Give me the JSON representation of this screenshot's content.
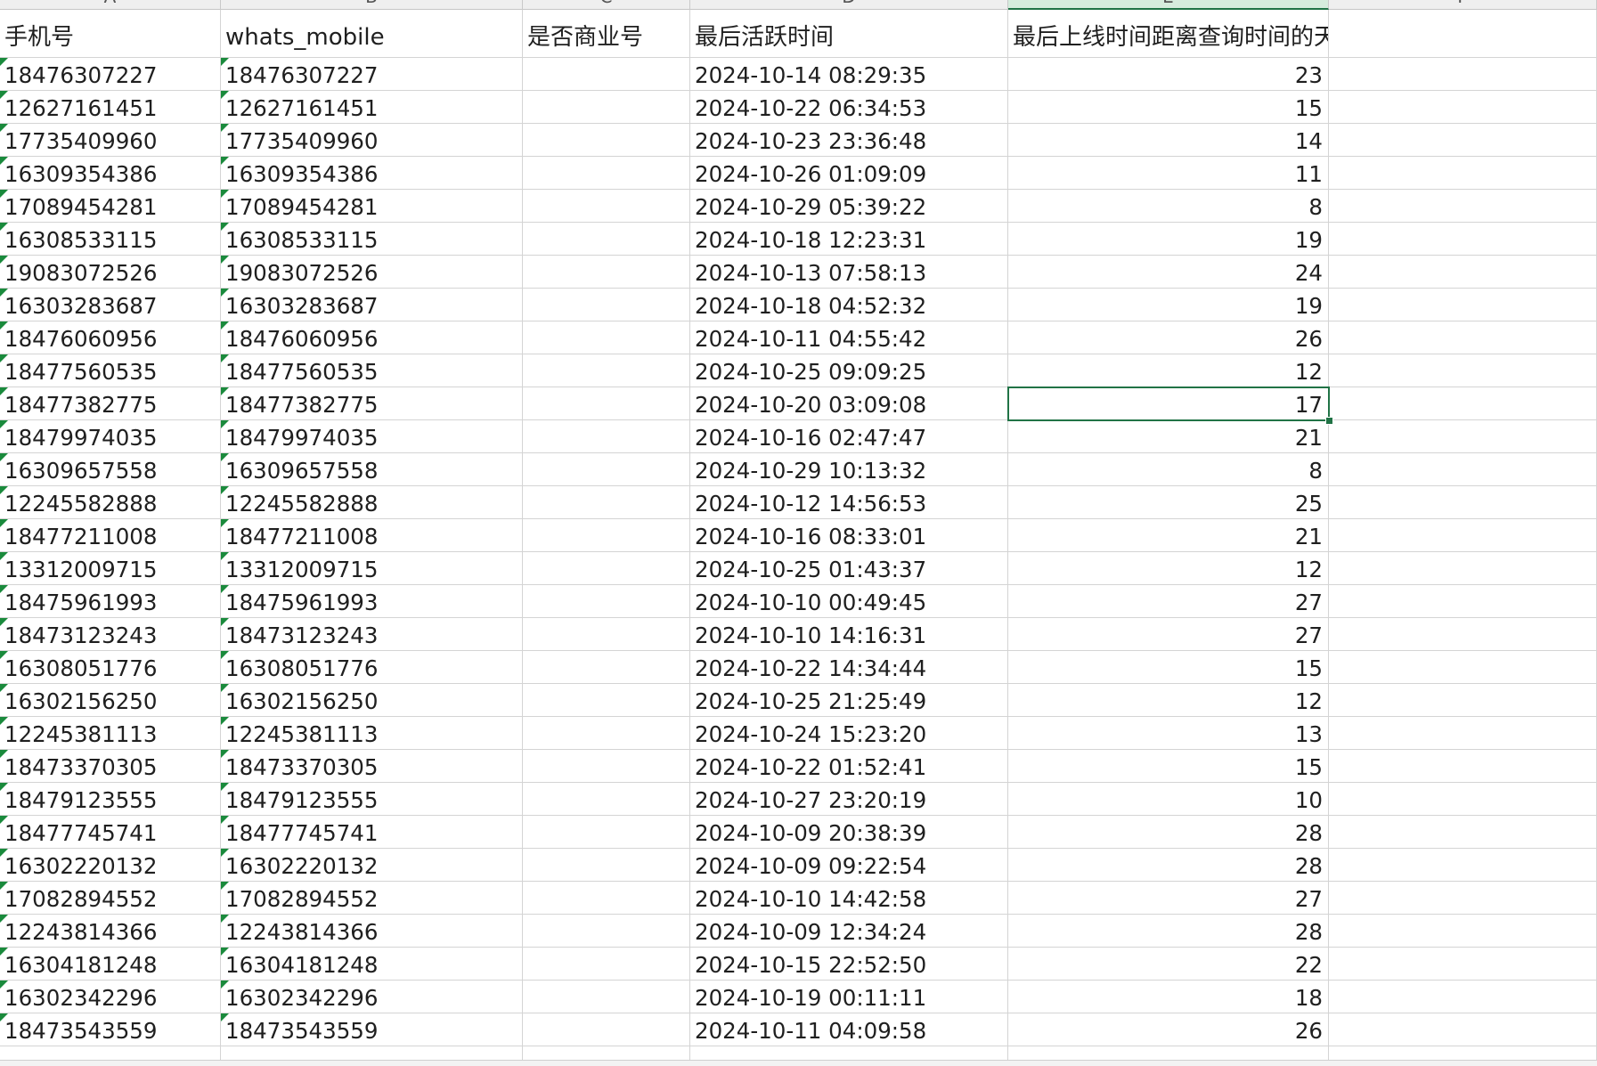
{
  "headers": [
    "手机号",
    "whats_mobile",
    "是否商业号",
    "最后活跃时间",
    "最后上线时间距离查询时间的天数",
    ""
  ],
  "rows": [
    [
      "18476307227",
      "18476307227",
      "",
      "2024-10-14 08:29:35",
      "23",
      ""
    ],
    [
      "12627161451",
      "12627161451",
      "",
      "2024-10-22 06:34:53",
      "15",
      ""
    ],
    [
      "17735409960",
      "17735409960",
      "",
      "2024-10-23 23:36:48",
      "14",
      ""
    ],
    [
      "16309354386",
      "16309354386",
      "",
      "2024-10-26 01:09:09",
      "11",
      ""
    ],
    [
      "17089454281",
      "17089454281",
      "",
      "2024-10-29 05:39:22",
      "8",
      ""
    ],
    [
      "16308533115",
      "16308533115",
      "",
      "2024-10-18 12:23:31",
      "19",
      ""
    ],
    [
      "19083072526",
      "19083072526",
      "",
      "2024-10-13 07:58:13",
      "24",
      ""
    ],
    [
      "16303283687",
      "16303283687",
      "",
      "2024-10-18 04:52:32",
      "19",
      ""
    ],
    [
      "18476060956",
      "18476060956",
      "",
      "2024-10-11 04:55:42",
      "26",
      ""
    ],
    [
      "18477560535",
      "18477560535",
      "",
      "2024-10-25 09:09:25",
      "12",
      ""
    ],
    [
      "18477382775",
      "18477382775",
      "",
      "2024-10-20 03:09:08",
      "17",
      ""
    ],
    [
      "18479974035",
      "18479974035",
      "",
      "2024-10-16 02:47:47",
      "21",
      ""
    ],
    [
      "16309657558",
      "16309657558",
      "",
      "2024-10-29 10:13:32",
      "8",
      ""
    ],
    [
      "12245582888",
      "12245582888",
      "",
      "2024-10-12 14:56:53",
      "25",
      ""
    ],
    [
      "18477211008",
      "18477211008",
      "",
      "2024-10-16 08:33:01",
      "21",
      ""
    ],
    [
      "13312009715",
      "13312009715",
      "",
      "2024-10-25 01:43:37",
      "12",
      ""
    ],
    [
      "18475961993",
      "18475961993",
      "",
      "2024-10-10 00:49:45",
      "27",
      ""
    ],
    [
      "18473123243",
      "18473123243",
      "",
      "2024-10-10 14:16:31",
      "27",
      ""
    ],
    [
      "16308051776",
      "16308051776",
      "",
      "2024-10-22 14:34:44",
      "15",
      ""
    ],
    [
      "16302156250",
      "16302156250",
      "",
      "2024-10-25 21:25:49",
      "12",
      ""
    ],
    [
      "12245381113",
      "12245381113",
      "",
      "2024-10-24 15:23:20",
      "13",
      ""
    ],
    [
      "18473370305",
      "18473370305",
      "",
      "2024-10-22 01:52:41",
      "15",
      ""
    ],
    [
      "18479123555",
      "18479123555",
      "",
      "2024-10-27 23:20:19",
      "10",
      ""
    ],
    [
      "18477745741",
      "18477745741",
      "",
      "2024-10-09 20:38:39",
      "28",
      ""
    ],
    [
      "16302220132",
      "16302220132",
      "",
      "2024-10-09 09:22:54",
      "28",
      ""
    ],
    [
      "17082894552",
      "17082894552",
      "",
      "2024-10-10 14:42:58",
      "27",
      ""
    ],
    [
      "12243814366",
      "12243814366",
      "",
      "2024-10-09 12:34:24",
      "28",
      ""
    ],
    [
      "16304181248",
      "16304181248",
      "",
      "2024-10-15 22:52:50",
      "22",
      ""
    ],
    [
      "16302342296",
      "16302342296",
      "",
      "2024-10-19 00:11:11",
      "18",
      ""
    ],
    [
      "18473543559",
      "18473543559",
      "",
      "2024-10-11 04:09:58",
      "26",
      ""
    ]
  ],
  "selected_cell": {
    "row": 10,
    "col": 4,
    "value": "17"
  },
  "colors": {
    "accent": "#217346",
    "text_marker": "#1a8a3c"
  }
}
